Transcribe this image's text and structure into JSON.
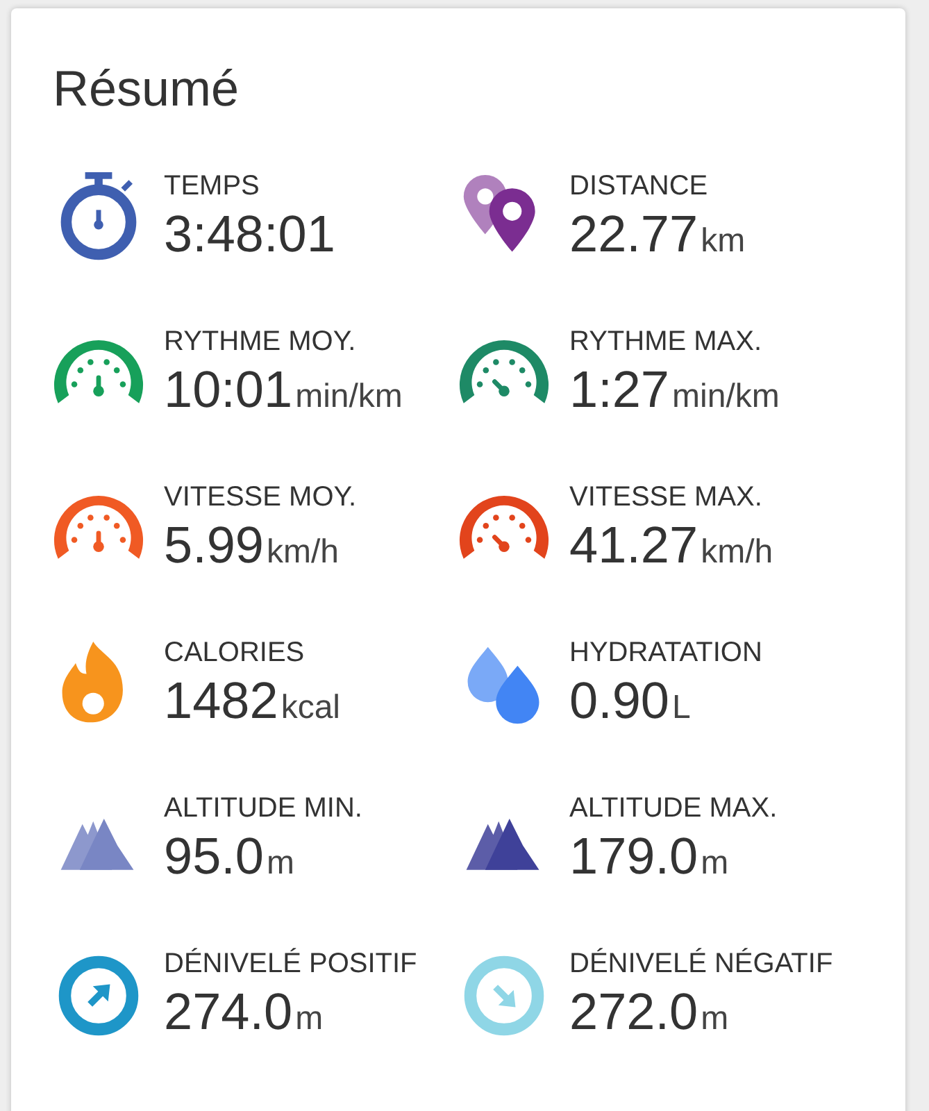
{
  "title": "Résumé",
  "stats": [
    {
      "kind": "stopwatch",
      "color": "#3f5fb0",
      "label": "TEMPS",
      "value": "3:48:01"
    },
    {
      "kind": "pins",
      "color": "#7b2d91",
      "label": "DISTANCE",
      "value": "22.77",
      "unit": "km"
    },
    {
      "kind": "gauge",
      "color": "#17a05a",
      "label": "RYTHME MOY.",
      "value": "10:01",
      "unit": "min/km"
    },
    {
      "kind": "peakgauge",
      "color": "#1e8a66",
      "label": "RYTHME MAX.",
      "value": "1:27",
      "unit": "min/km"
    },
    {
      "kind": "gauge",
      "color": "#f05a24",
      "label": "VITESSE MOY.",
      "value": "5.99",
      "unit": "km/h"
    },
    {
      "kind": "peakgauge",
      "color": "#e2441c",
      "label": "VITESSE MAX.",
      "value": "41.27",
      "unit": "km/h"
    },
    {
      "kind": "flame",
      "color": "#f7941d",
      "label": "CALORIES",
      "value": "1482",
      "unit": "kcal"
    },
    {
      "kind": "drops",
      "color": "#4285f4",
      "label": "HYDRATATION",
      "value": "0.90",
      "unit": "L"
    },
    {
      "kind": "mountains",
      "color": "#7986c4",
      "label": "ALTITUDE MIN.",
      "value": "95.0",
      "unit": "m"
    },
    {
      "kind": "mountains",
      "color": "#3f4199",
      "label": "ALTITUDE MAX.",
      "value": "179.0",
      "unit": "m"
    },
    {
      "kind": "ascent",
      "color": "#1e96c8",
      "label": "DÉNIVELÉ POSITIF",
      "value": "274.0",
      "unit": "m"
    },
    {
      "kind": "descent",
      "color": "#8fd6e6",
      "label": "DÉNIVELÉ NÉGATIF",
      "value": "272.0",
      "unit": "m"
    }
  ]
}
